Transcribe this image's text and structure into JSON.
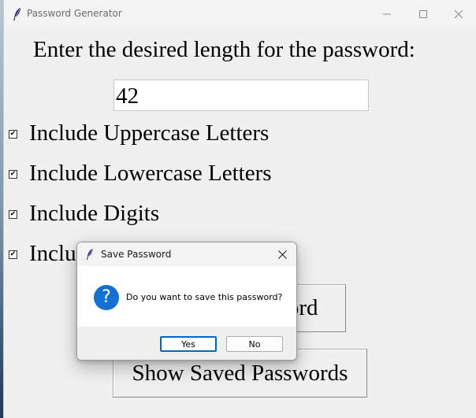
{
  "window": {
    "title": "Password Generator",
    "controls": {
      "minimize_icon": "minimize-icon",
      "maximize_icon": "maximize-icon",
      "close_icon": "close-icon"
    }
  },
  "form": {
    "prompt": "Enter the desired length for the password:",
    "length_value": "42",
    "options": [
      {
        "label": "Include Uppercase Letters",
        "checked": true
      },
      {
        "label": "Include Lowercase Letters",
        "checked": true
      },
      {
        "label": "Include Digits",
        "checked": true
      },
      {
        "label": "Include Special Characters",
        "checked": true
      }
    ],
    "generate_button": "Generate Password",
    "show_saved_button": "Show Saved Passwords"
  },
  "dialog": {
    "title": "Save Password",
    "message": "Do you want to save this password?",
    "icon": "question-icon",
    "yes_label": "Yes",
    "no_label": "No"
  },
  "colors": {
    "window_bg": "#f0f0f0",
    "accent": "#0067c0",
    "question_icon": "#1570d0"
  }
}
